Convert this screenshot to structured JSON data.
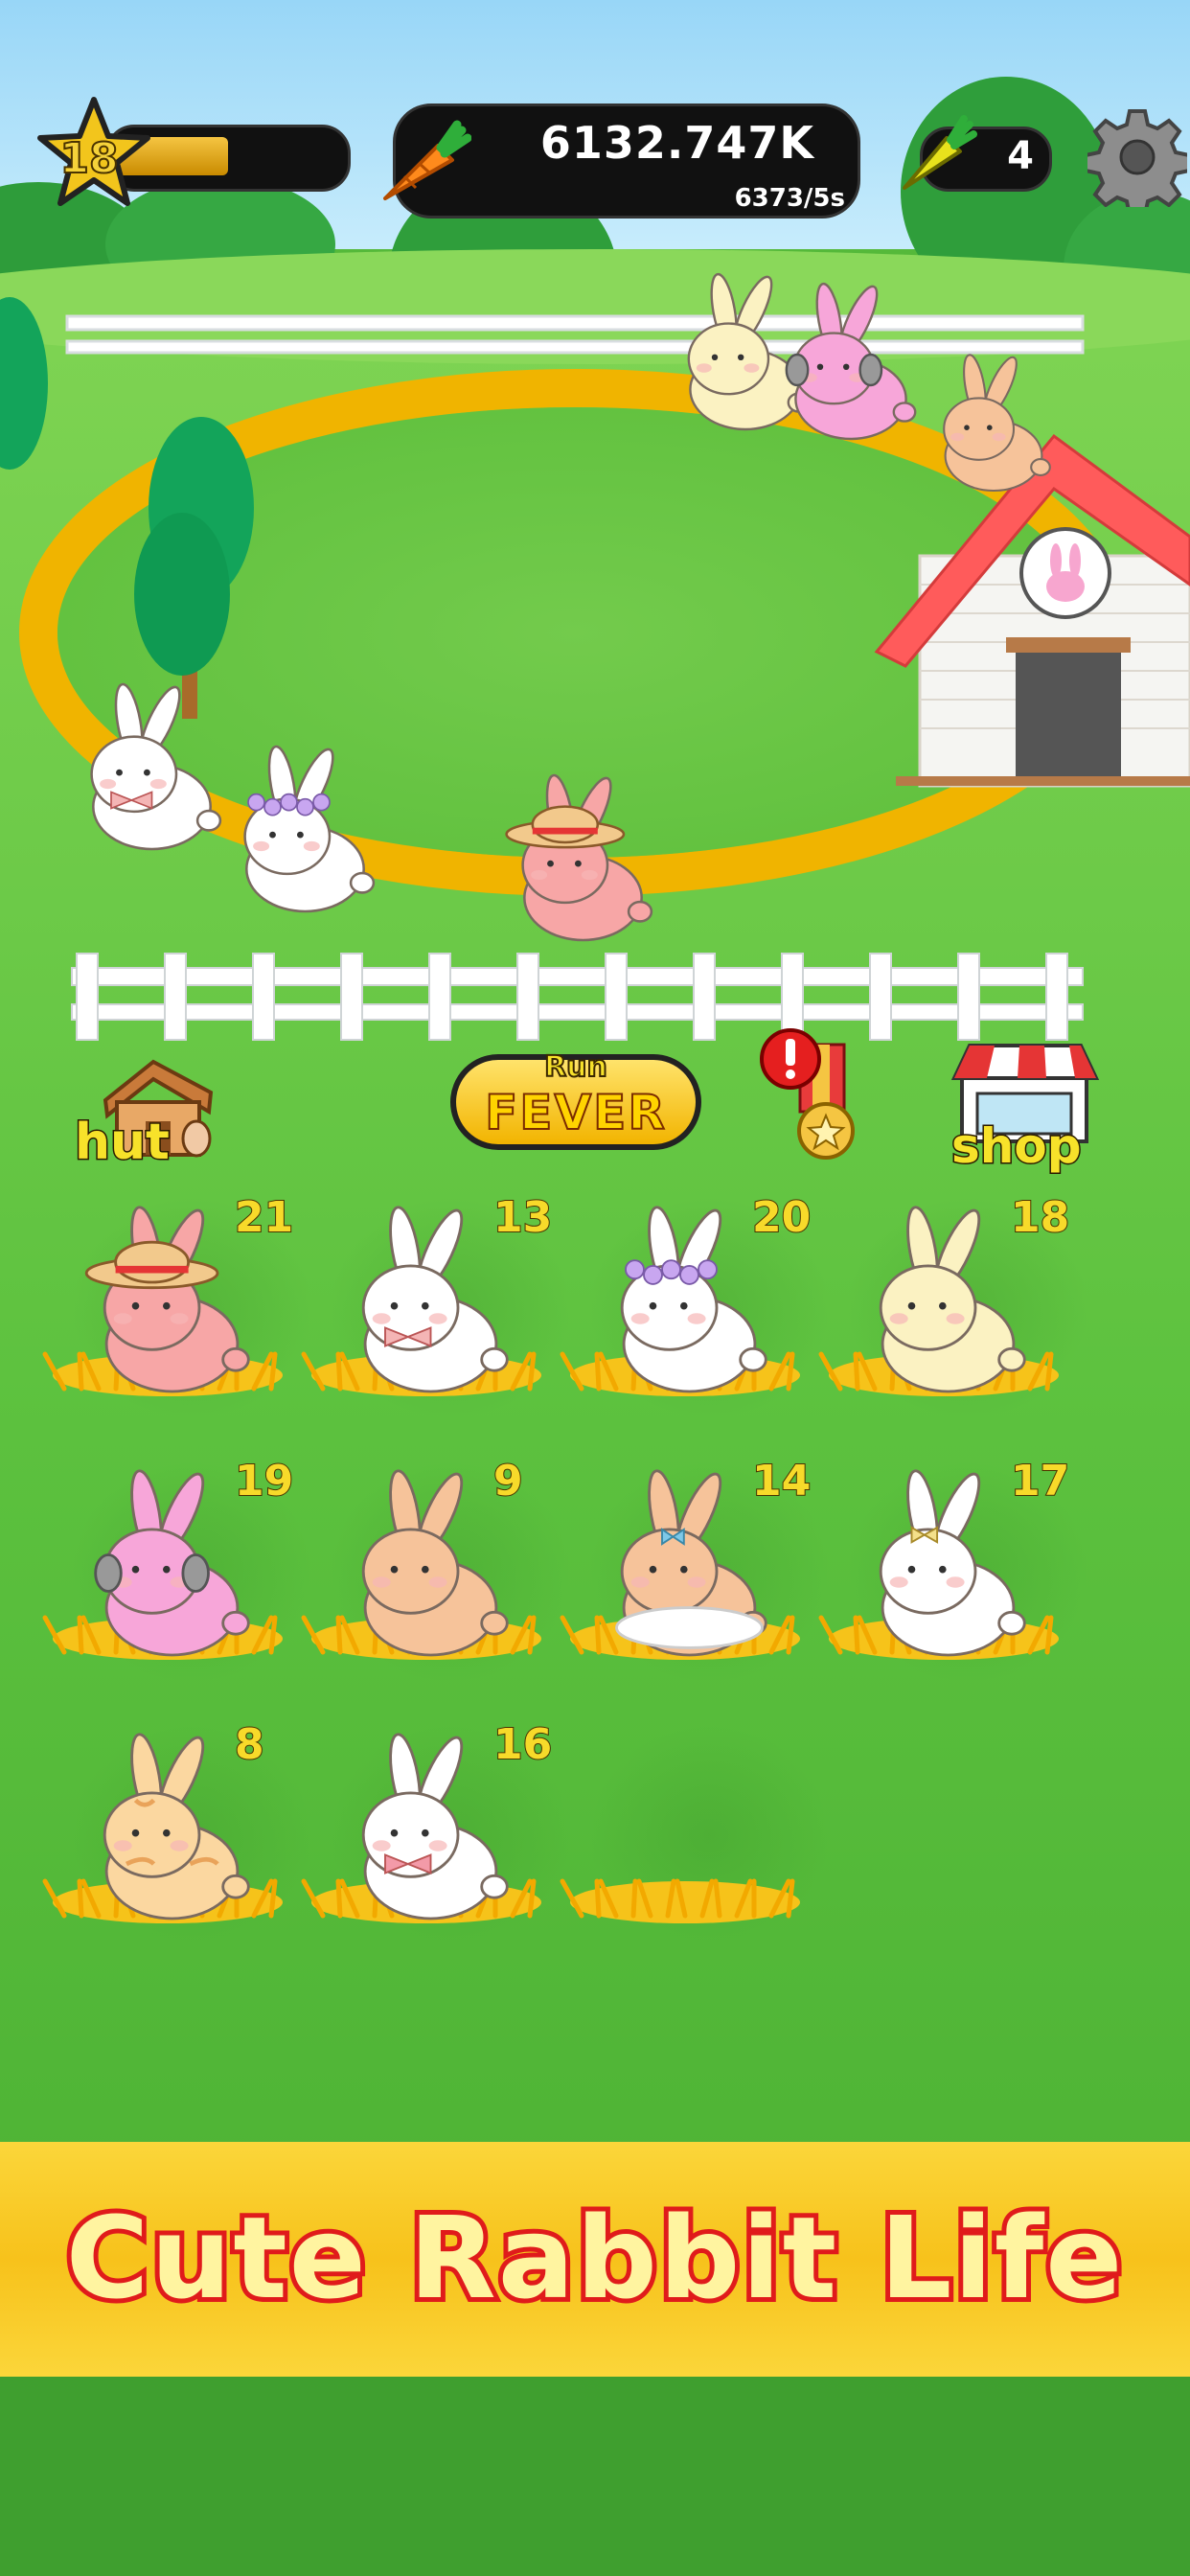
{
  "hud": {
    "level": "18",
    "level_progress": 0.5,
    "money": "6132.747K",
    "rate": "6373/5s",
    "tickets": "4"
  },
  "buttons": {
    "hut": "hut",
    "fever_top": "Run",
    "fever": "FEVER",
    "shop": "shop"
  },
  "slots": [
    {
      "level": "21",
      "rabbit": "pink-hat"
    },
    {
      "level": "13",
      "rabbit": "white-bow"
    },
    {
      "level": "20",
      "rabbit": "white-flower"
    },
    {
      "level": "18",
      "rabbit": "cream"
    },
    {
      "level": "19",
      "rabbit": "pink-headphones"
    },
    {
      "level": "9",
      "rabbit": "peach"
    },
    {
      "level": "14",
      "rabbit": "peach-tutu"
    },
    {
      "level": "17",
      "rabbit": "white-fluffy"
    },
    {
      "level": "8",
      "rabbit": "orange-tabby"
    },
    {
      "level": "16",
      "rabbit": "white-scarf"
    },
    {
      "level": "",
      "rabbit": "empty"
    }
  ],
  "banner": {
    "title": "Cute Rabbit Life"
  },
  "colors": {
    "sky": "#a8defa",
    "grass": "#55b93a",
    "path": "#f0b400",
    "banner": "#f7c21b",
    "banner_text_outline": "#e01b1b"
  }
}
